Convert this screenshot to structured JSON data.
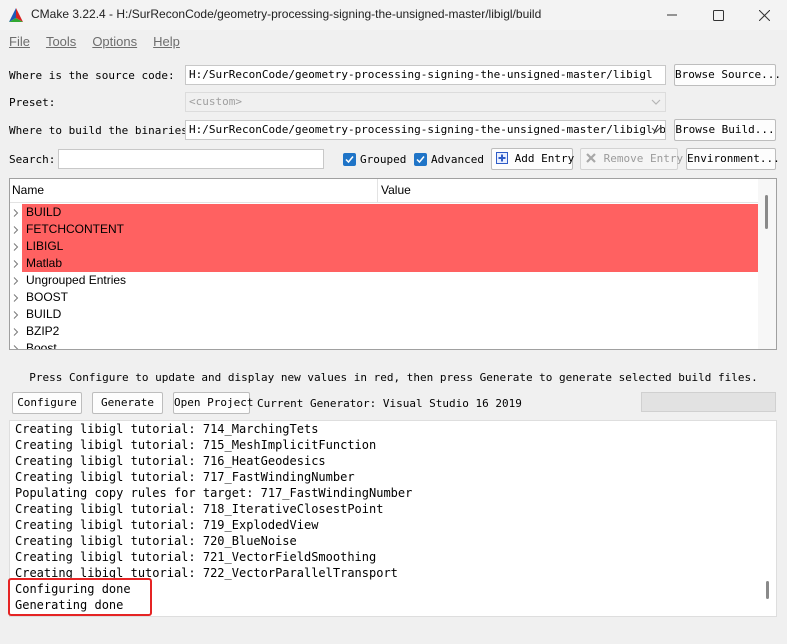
{
  "window": {
    "title": "CMake 3.22.4 - H:/SurReconCode/geometry-processing-signing-the-unsigned-master/libigl/build",
    "icon": "cmake-logo-icon",
    "minimize_icon": "minimize-icon",
    "maximize_icon": "maximize-icon",
    "close_icon": "close-icon"
  },
  "menu": [
    {
      "label": "File"
    },
    {
      "label": "Tools"
    },
    {
      "label": "Options"
    },
    {
      "label": "Help"
    }
  ],
  "source": {
    "label": "Where is the source code:",
    "value": "H:/SurReconCode/geometry-processing-signing-the-unsigned-master/libigl",
    "browse_label": "Browse Source..."
  },
  "preset": {
    "label": "Preset:",
    "value": "<custom>"
  },
  "build": {
    "label": "Where to build the binaries:",
    "value": "H:/SurReconCode/geometry-processing-signing-the-unsigned-master/libigl/build",
    "browse_label": "Browse Build..."
  },
  "search": {
    "label": "Search:",
    "value": ""
  },
  "options": {
    "grouped_label": "Grouped",
    "grouped_checked": true,
    "advanced_label": "Advanced",
    "advanced_checked": true,
    "add_entry_label": "Add Entry",
    "remove_entry_label": "Remove Entry",
    "environment_label": "Environment..."
  },
  "table": {
    "columns": [
      "Name",
      "Value"
    ],
    "rows": [
      {
        "name": "BUILD",
        "new": true
      },
      {
        "name": "FETCHCONTENT",
        "new": true
      },
      {
        "name": "LIBIGL",
        "new": true
      },
      {
        "name": "Matlab",
        "new": true
      },
      {
        "name": "Ungrouped Entries",
        "new": false
      },
      {
        "name": "BOOST",
        "new": false
      },
      {
        "name": "BUILD",
        "new": false
      },
      {
        "name": "BZIP2",
        "new": false
      },
      {
        "name": "Boost",
        "new": false
      }
    ],
    "new_color": "#ff6161"
  },
  "hint": "Press Configure to update and display new values in red, then press Generate to generate selected build files.",
  "actions": {
    "configure_label": "Configure",
    "generate_label": "Generate",
    "open_project_label": "Open Project",
    "generator_text": "Current Generator: Visual Studio 16 2019"
  },
  "output": {
    "lines": [
      "Creating libigl tutorial: 714_MarchingTets",
      "Creating libigl tutorial: 715_MeshImplicitFunction",
      "Creating libigl tutorial: 716_HeatGeodesics",
      "Creating libigl tutorial: 717_FastWindingNumber",
      "Populating copy rules for target: 717_FastWindingNumber",
      "Creating libigl tutorial: 718_IterativeClosestPoint",
      "Creating libigl tutorial: 719_ExplodedView",
      "Creating libigl tutorial: 720_BlueNoise",
      "Creating libigl tutorial: 721_VectorFieldSmoothing",
      "Creating libigl tutorial: 722_VectorParallelTransport",
      "Configuring done",
      "Generating done"
    ],
    "annotation_color": "#e52424"
  }
}
